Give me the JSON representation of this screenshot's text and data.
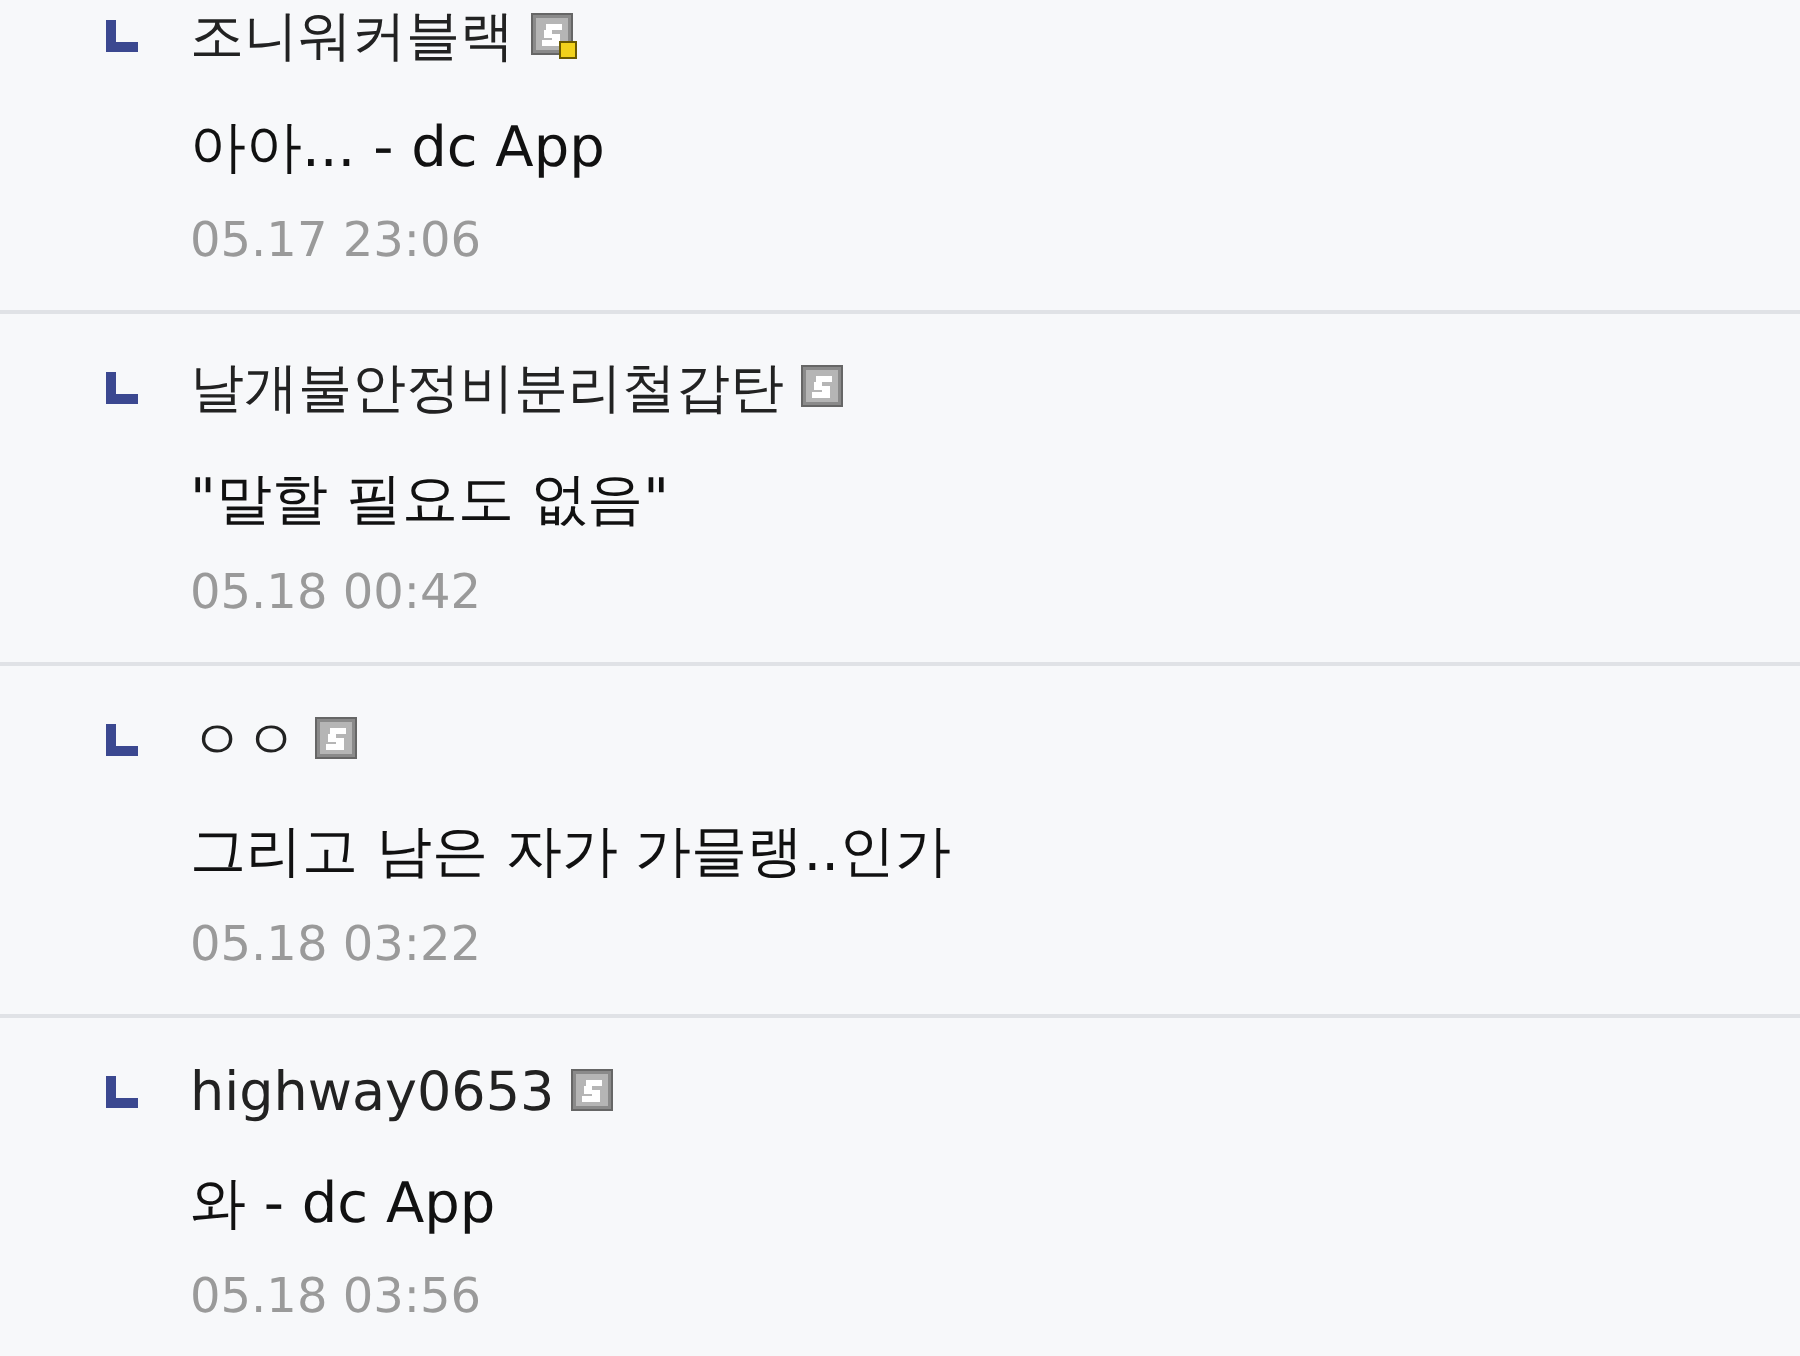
{
  "replies": [
    {
      "author": "조니워커블랙",
      "dot": true,
      "text": "아아... - dc App",
      "time": "05.17 23:06"
    },
    {
      "author": "날개불안정비분리철갑탄",
      "dot": false,
      "text": "\"말할 필요도 없음\"",
      "time": "05.18 00:42"
    },
    {
      "author": "ㅇㅇ",
      "dot": false,
      "text": "그리고 남은 자가 가믈랭..인가",
      "time": "05.18 03:22"
    },
    {
      "author": "highway0653",
      "dot": false,
      "text": "와 - dc App",
      "time": "05.18 03:56"
    }
  ]
}
